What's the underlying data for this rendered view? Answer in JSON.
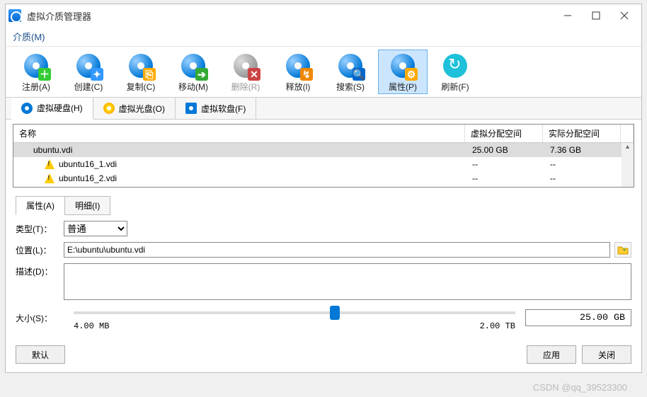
{
  "window": {
    "title": "虚拟介质管理器"
  },
  "menu": {
    "media": "介质(M)"
  },
  "toolbar": {
    "register": "注册(A)",
    "create": "创建(C)",
    "copy": "复制(C)",
    "move": "移动(M)",
    "delete": "删除(R)",
    "release": "释放(l)",
    "search": "搜索(S)",
    "properties": "属性(P)",
    "refresh": "刷新(F)"
  },
  "mediaTabs": {
    "hdd": "虚拟硬盘(H)",
    "cd": "虚拟光盘(O)",
    "fd": "虚拟软盘(F)"
  },
  "list": {
    "headers": {
      "name": "名称",
      "vsize": "虚拟分配空间",
      "asize": "实际分配空间"
    },
    "rows": [
      {
        "name": "ubuntu.vdi",
        "vsize": "25.00 GB",
        "asize": "7.36 GB",
        "selected": true,
        "indent": 1,
        "warn": false
      },
      {
        "name": "ubuntu16_1.vdi",
        "vsize": "--",
        "asize": "--",
        "selected": false,
        "indent": 2,
        "warn": true
      },
      {
        "name": "ubuntu16_2.vdi",
        "vsize": "--",
        "asize": "--",
        "selected": false,
        "indent": 2,
        "warn": true
      }
    ]
  },
  "propTabs": {
    "attr": "属性(A)",
    "detail": "明细(I)"
  },
  "form": {
    "type_label": "类型(T)：",
    "type_value": "普通",
    "location_label": "位置(L)：",
    "location_value": "E:\\ubuntu\\ubuntu.vdi",
    "desc_label": "描述(D)：",
    "desc_value": "",
    "size_label": "大小(S)：",
    "size_min": "4.00 MB",
    "size_max": "2.00 TB",
    "size_value": "25.00 GB",
    "slider_percent": 58
  },
  "footer": {
    "default": "默认",
    "apply": "应用",
    "close": "关闭"
  },
  "watermark": "CSDN @qq_39523300"
}
